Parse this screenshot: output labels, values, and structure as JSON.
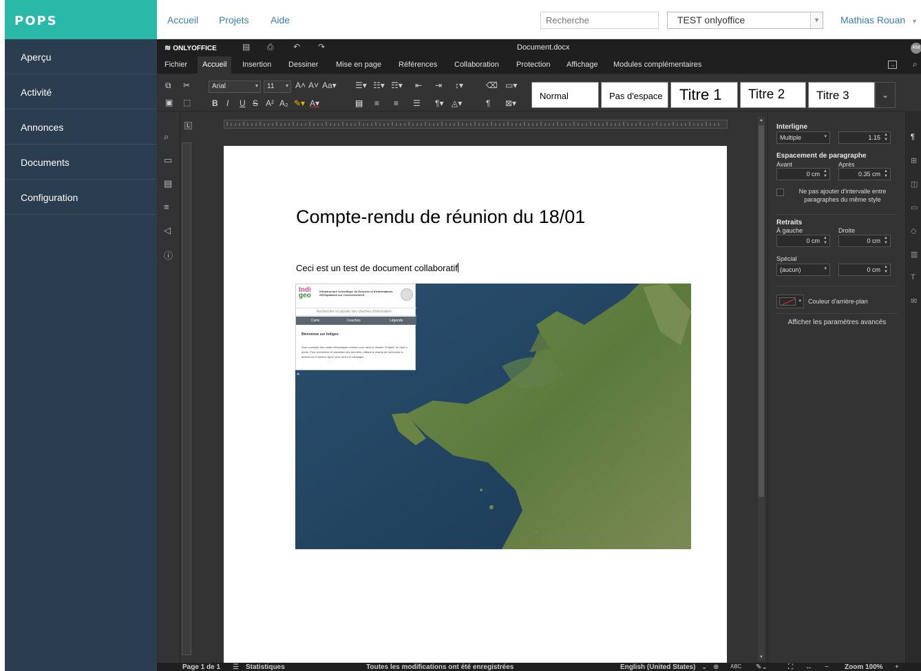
{
  "pops": {
    "logo": "POPS",
    "sidebar": [
      {
        "label": "Aperçu"
      },
      {
        "label": "Activité"
      },
      {
        "label": "Annonces"
      },
      {
        "label": "Documents"
      },
      {
        "label": "Configuration"
      }
    ],
    "topnav": [
      {
        "label": "Accueil"
      },
      {
        "label": "Projets"
      },
      {
        "label": "Aide"
      }
    ],
    "search_placeholder": "Recherche",
    "project_selected": "TEST onlyoffice",
    "user": "Mathias Rouan"
  },
  "editor": {
    "brand": "ONLYOFFICE",
    "document_title": "Document.docx",
    "avatar_initials": "RM",
    "tabs": [
      {
        "label": "Fichier"
      },
      {
        "label": "Accueil"
      },
      {
        "label": "Insertion"
      },
      {
        "label": "Dessiner"
      },
      {
        "label": "Mise en page"
      },
      {
        "label": "Références"
      },
      {
        "label": "Collaboration"
      },
      {
        "label": "Protection"
      },
      {
        "label": "Affichage"
      },
      {
        "label": "Modules complémentaires"
      }
    ],
    "toolbar": {
      "font_name": "Arial",
      "font_size": "11",
      "styles": [
        {
          "label": "Normal"
        },
        {
          "label": "Pas d'espace"
        },
        {
          "label": "Titre 1"
        },
        {
          "label": "Titre 2"
        },
        {
          "label": "Titre 3"
        }
      ]
    },
    "document": {
      "heading": "Compte-rendu de réunion du 18/01",
      "paragraph": "Ceci est un test de document collaboratif"
    },
    "embedded_image": {
      "logo_top": "Indi",
      "logo_bottom": "geo",
      "title": "Infrastructure scientifique de Données et d'Informations GEOspatiales sur l'environnement",
      "search_placeholder": "Rechercher ou ajouter des couches d'information",
      "tabs": [
        "Carte",
        "Couches",
        "Légende"
      ],
      "welcome": "Bienvenue sur Indigeo",
      "text": "Pour consulter des cartes thématiques rendez-vous dans le dossier \"Projets\" en haut à droite. Pour rechercher et visualiser des données, utilisez le champ de recherche ci-dessus ou le bouton 'Ajout' pour ouvrir le catalogue.",
      "collapse_glyph": "^"
    },
    "paragraph_settings": {
      "line_spacing_label": "Interligne",
      "line_spacing_mode": "Multiple",
      "line_spacing_value": "1.15",
      "spacing_label": "Espacement de paragraphe",
      "before_label": "Avant",
      "after_label": "Après",
      "before_value": "0 cm",
      "after_value": "0.35 cm",
      "no_interval_label": "Ne pas ajouter d'intervalle entre paragraphes du même style",
      "indents_label": "Retraits",
      "left_label": "À gauche",
      "right_label": "Droite",
      "left_value": "0 cm",
      "right_value": "0 cm",
      "special_label": "Spécial",
      "special_value": "(aucun)",
      "special_cm": "0 cm",
      "bgcolor_label": "Couleur d'arrière-plan",
      "advanced_label": "Afficher les paramètres avancés"
    },
    "statusbar": {
      "page": "Page 1 de 1",
      "stats": "Statistiques",
      "saved": "Toutes les modifications ont été enregistrées",
      "language": "English (United States)",
      "zoom": "Zoom 100%"
    }
  },
  "colors": {
    "pops_teal": "#2ab9a8",
    "pops_sidebar": "#2b3e50",
    "link_blue": "#3a7fb6",
    "editor_dark": "#333333",
    "spellcheck_red": "#d33333"
  }
}
